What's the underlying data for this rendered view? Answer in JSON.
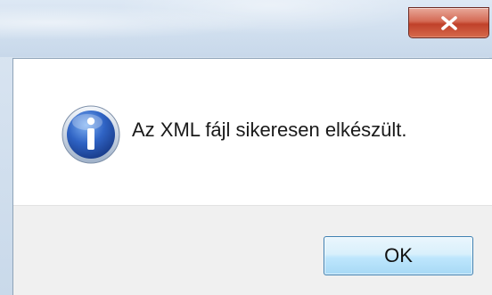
{
  "dialog": {
    "close_glyph": "x",
    "message": "Az XML fájl sikeresen elkészült.",
    "icon": "information-icon",
    "ok_label": "OK"
  },
  "colors": {
    "close_button": "#c8432c",
    "ok_border": "#3c7fb1",
    "footer_bg": "#f0f0f0",
    "icon_blue": "#2f63c4"
  }
}
